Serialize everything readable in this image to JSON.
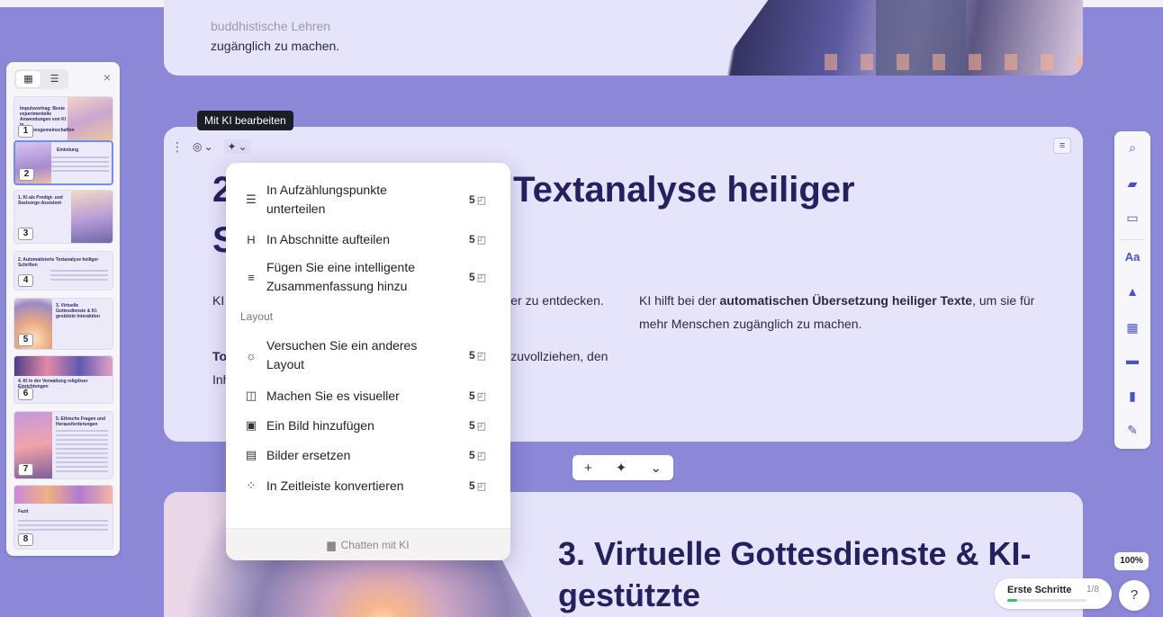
{
  "colors": {
    "canvas_bg": "#8c87d6",
    "card_bg": "#e6e4fb",
    "heading": "#25215e",
    "accent_icon": "#4a52c9",
    "progress": "#36c26a"
  },
  "card1": {
    "text_line1": "buddhistische Lehren",
    "text_line2": "zugänglich zu machen."
  },
  "card2": {
    "heading": "2. Automatisierte Textanalyse heiliger Schriften",
    "para_left1": "KI erkennt und analysiert Themen, Sprache und Muster zu entdecken.",
    "para_left2_bold": "Tools wie",
    "para_left2_rest": " ermöglichen es, das Zusammenhang nachzuvollziehen, den Inhalt tiefer ausleuchten und verständlich macht.",
    "para_right_pre": "KI hilft bei der ",
    "para_right_bold": "automatischen Übersetzung heiliger Texte",
    "para_right_post": ", um sie für mehr Menschen zugänglich zu machen."
  },
  "card3": {
    "heading": "3. Virtuelle Gottesdienste & KI-gestützte"
  },
  "tooltip": "Mit KI bearbeiten",
  "add_bar": {
    "plus_icon": "+",
    "ai_icon": "sparkle-icon",
    "chevron_icon": "chevron-down-icon"
  },
  "ai_menu": {
    "items": [
      {
        "icon": "list-bullets-icon",
        "label": "In Aufzählungspunkte unterteilen",
        "credits": "5"
      },
      {
        "icon": "heading-icon",
        "label": "In Abschnitte aufteilen",
        "credits": "5"
      },
      {
        "icon": "summary-icon",
        "label": "Fügen Sie eine intelligente Zusammenfassung hinzu",
        "credits": "5"
      }
    ],
    "section_label": "Layout",
    "layout_items": [
      {
        "icon": "lightbulb-icon",
        "label": "Versuchen Sie ein anderes Layout",
        "credits": "5"
      },
      {
        "icon": "visual-icon",
        "label": "Machen Sie es visueller",
        "credits": "5"
      },
      {
        "icon": "image-add-icon",
        "label": "Ein Bild hinzufügen",
        "credits": "5"
      },
      {
        "icon": "image-replace-icon",
        "label": "Bilder ersetzen",
        "credits": "5"
      },
      {
        "icon": "timeline-icon",
        "label": "In Zeitleiste konvertieren",
        "credits": "5"
      }
    ],
    "footer": "Chatten mit KI"
  },
  "thumbnails": [
    {
      "num": "1",
      "title": "Impulsvortrag: Beste experimentelle Anwendungen von KI in Religionsgemeinschaften"
    },
    {
      "num": "2",
      "title": "Einleitung"
    },
    {
      "num": "3",
      "title": "1. KI als Predigt- und Seelsorge-Assistent"
    },
    {
      "num": "4",
      "title": "2. Automatisierte Textanalyse heiliger Schriften"
    },
    {
      "num": "5",
      "title": "3. Virtuelle Gottesdienste & KI-gestützte Interaktion"
    },
    {
      "num": "6",
      "title": "4. KI in der Verwaltung religiöser Einrichtungen"
    },
    {
      "num": "7",
      "title": "5. Ethische Fragen und Herausforderungen"
    },
    {
      "num": "8",
      "title": "Fazit"
    }
  ],
  "right_tools": [
    "search-icon",
    "add-card-icon",
    "layout-icon",
    "text-style-icon",
    "image-icon",
    "media-icon",
    "card-icon",
    "chart-icon",
    "edit-icon"
  ],
  "zoom": "100%",
  "onboarding": {
    "label": "Erste Schritte",
    "count": "1/8",
    "progress": 0.125
  },
  "help": "?"
}
